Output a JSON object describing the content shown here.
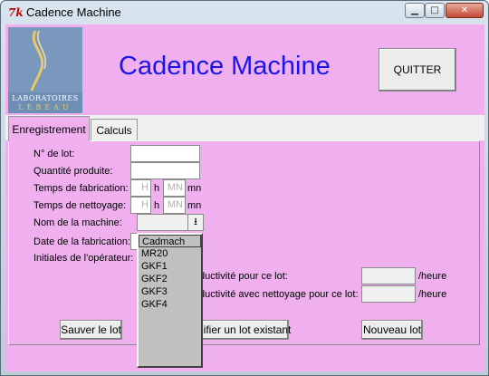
{
  "window": {
    "title": "Cadence Machine",
    "icon": "tk-feather-icon"
  },
  "header": {
    "logo": {
      "line1": "LABORATOIRES",
      "line2": "LEBEAU"
    },
    "app_title": "Cadence Machine",
    "quit_label": "QUITTER"
  },
  "tabs": [
    {
      "label": "Enregistrement"
    },
    {
      "label": "Calculs"
    }
  ],
  "form": {
    "lot_label": "N° de lot:",
    "quantity_label": "Quantité produite:",
    "fab_time_label": "Temps de fabrication:",
    "clean_time_label": "Temps de nettoyage:",
    "hours_placeholder": "H",
    "minutes_placeholder": "MN",
    "h_unit": "h",
    "mn_unit": "mn",
    "machine_label": "Nom de la machine:",
    "date_label": "Date de la fabrication:",
    "initials_label": "Initiales de l'opérateur:",
    "productivity_label": "ductivité pour ce lot:",
    "productivity_clean_label": "ductivité avec nettoyage pour ce lot:",
    "per_hour": "/heure"
  },
  "machine_options": [
    "Cadmach",
    "MR20",
    "GKF1",
    "GKF2",
    "GKF3",
    "GKF4"
  ],
  "buttons": {
    "save": "Sauver le lot",
    "modify": "difier un lot existant",
    "new": "Nouveau lot"
  }
}
